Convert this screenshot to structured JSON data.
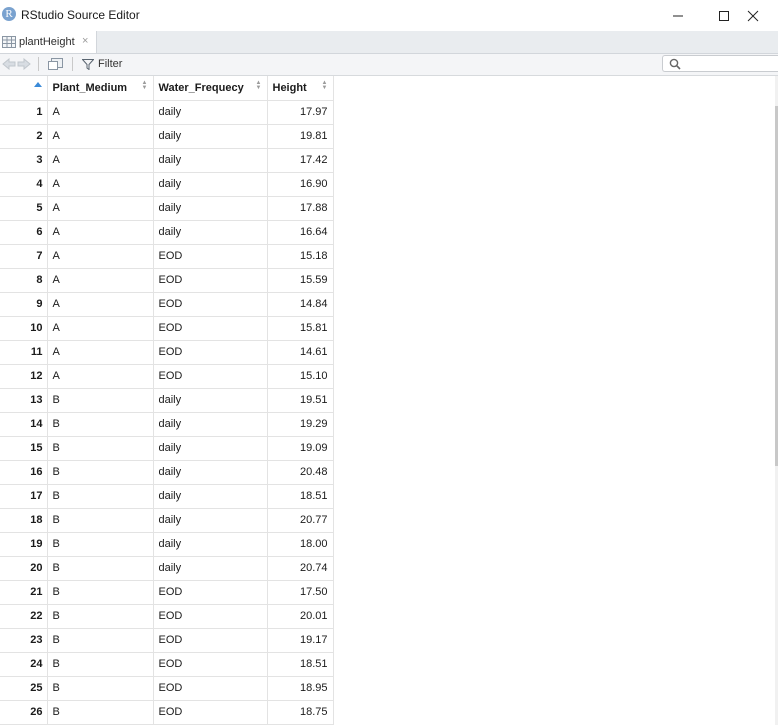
{
  "window": {
    "title": "RStudio Source Editor",
    "logo_letter": "R"
  },
  "tab": {
    "label": "plantHeight",
    "close_glyph": "×"
  },
  "toolbar": {
    "filter_label": "Filter",
    "search_value": ""
  },
  "table": {
    "columns": [
      "Plant_Medium",
      "Water_Frequecy",
      "Height"
    ],
    "rows": [
      [
        "1",
        "A",
        "daily",
        "17.97"
      ],
      [
        "2",
        "A",
        "daily",
        "19.81"
      ],
      [
        "3",
        "A",
        "daily",
        "17.42"
      ],
      [
        "4",
        "A",
        "daily",
        "16.90"
      ],
      [
        "5",
        "A",
        "daily",
        "17.88"
      ],
      [
        "6",
        "A",
        "daily",
        "16.64"
      ],
      [
        "7",
        "A",
        "EOD",
        "15.18"
      ],
      [
        "8",
        "A",
        "EOD",
        "15.59"
      ],
      [
        "9",
        "A",
        "EOD",
        "14.84"
      ],
      [
        "10",
        "A",
        "EOD",
        "15.81"
      ],
      [
        "11",
        "A",
        "EOD",
        "14.61"
      ],
      [
        "12",
        "A",
        "EOD",
        "15.10"
      ],
      [
        "13",
        "B",
        "daily",
        "19.51"
      ],
      [
        "14",
        "B",
        "daily",
        "19.29"
      ],
      [
        "15",
        "B",
        "daily",
        "19.09"
      ],
      [
        "16",
        "B",
        "daily",
        "20.48"
      ],
      [
        "17",
        "B",
        "daily",
        "18.51"
      ],
      [
        "18",
        "B",
        "daily",
        "20.77"
      ],
      [
        "19",
        "B",
        "daily",
        "18.00"
      ],
      [
        "20",
        "B",
        "daily",
        "20.74"
      ],
      [
        "21",
        "B",
        "EOD",
        "17.50"
      ],
      [
        "22",
        "B",
        "EOD",
        "20.01"
      ],
      [
        "23",
        "B",
        "EOD",
        "19.17"
      ],
      [
        "24",
        "B",
        "EOD",
        "18.51"
      ],
      [
        "25",
        "B",
        "EOD",
        "18.95"
      ],
      [
        "26",
        "B",
        "EOD",
        "18.75"
      ]
    ]
  }
}
